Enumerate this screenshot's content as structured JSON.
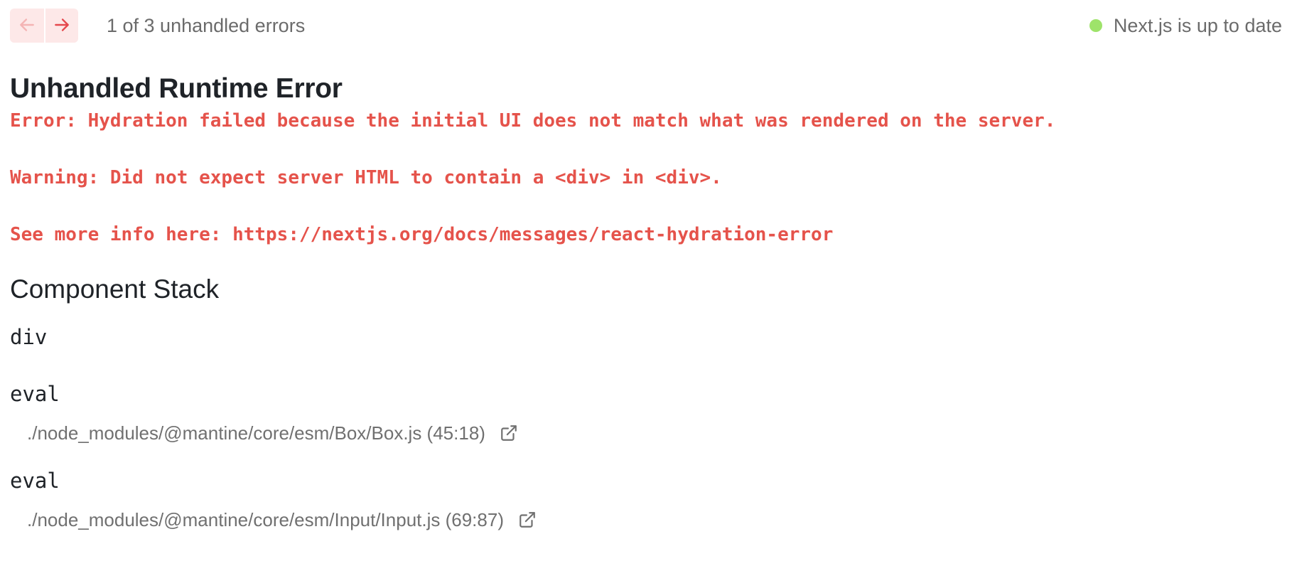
{
  "nav": {
    "prev_icon": "arrow-left-icon",
    "next_icon": "arrow-right-icon",
    "error_count_text": "1 of 3 unhandled errors"
  },
  "status": {
    "text": "Next.js is up to date",
    "dot_color": "#9ee36a"
  },
  "error": {
    "title": "Unhandled Runtime Error",
    "lines": [
      "Error: Hydration failed because the initial UI does not match what was rendered on the server.",
      "Warning: Did not expect server HTML to contain a <div> in <div>.",
      "See more info here: https://nextjs.org/docs/messages/react-hydration-error"
    ],
    "color": "#e5534b"
  },
  "component_stack": {
    "title": "Component Stack",
    "frames": [
      {
        "name": "div"
      },
      {
        "name": "eval",
        "location": "./node_modules/@mantine/core/esm/Box/Box.js (45:18)",
        "icon": "external-link-icon"
      },
      {
        "name": "eval",
        "location": "./node_modules/@mantine/core/esm/Input/Input.js (69:87)",
        "icon": "external-link-icon"
      }
    ]
  }
}
